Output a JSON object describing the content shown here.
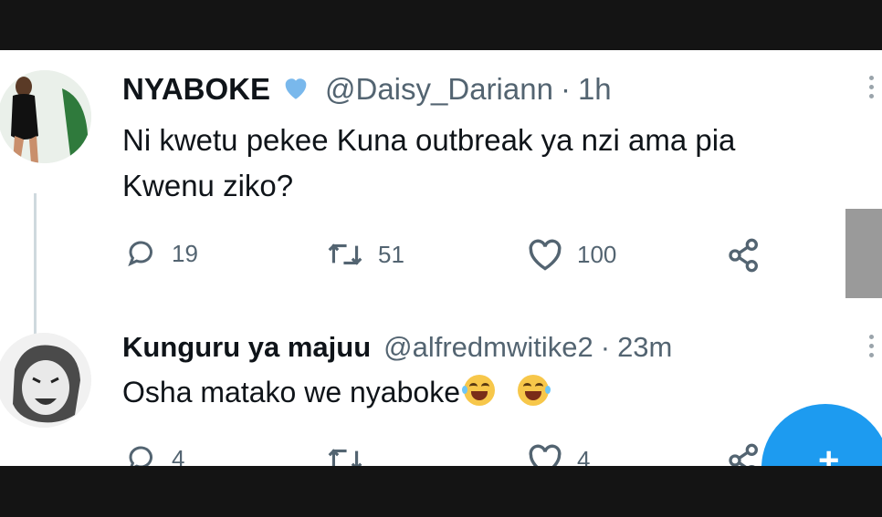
{
  "tweet": {
    "display_name": "NYABOKE",
    "handle": "@Daisy_Dariann",
    "separator": "·",
    "time": "1h",
    "text_line1": "Ni kwetu pekee Kuna outbreak ya nzi ama pia",
    "text_line2": "Kwenu ziko?",
    "replies": "19",
    "retweets": "51",
    "likes": "100",
    "verified_color": "#79b8ec"
  },
  "reply": {
    "display_name": "Kunguru ya majuu",
    "handle": "@alfredmwitike2",
    "separator": "·",
    "time": "23m",
    "text": "Osha matako we nyaboke",
    "emojis": [
      "face-with-tears-of-joy",
      "face-with-tears-of-joy"
    ],
    "replies": "4",
    "likes": "4"
  },
  "colors": {
    "accent": "#1d9bf0",
    "text": "#0f1419",
    "muted": "#536471",
    "frame": "#141414"
  },
  "icons": [
    "reply-icon",
    "retweet-icon",
    "like-icon",
    "share-icon",
    "verified-badge-icon",
    "more-icon",
    "compose-icon"
  ]
}
